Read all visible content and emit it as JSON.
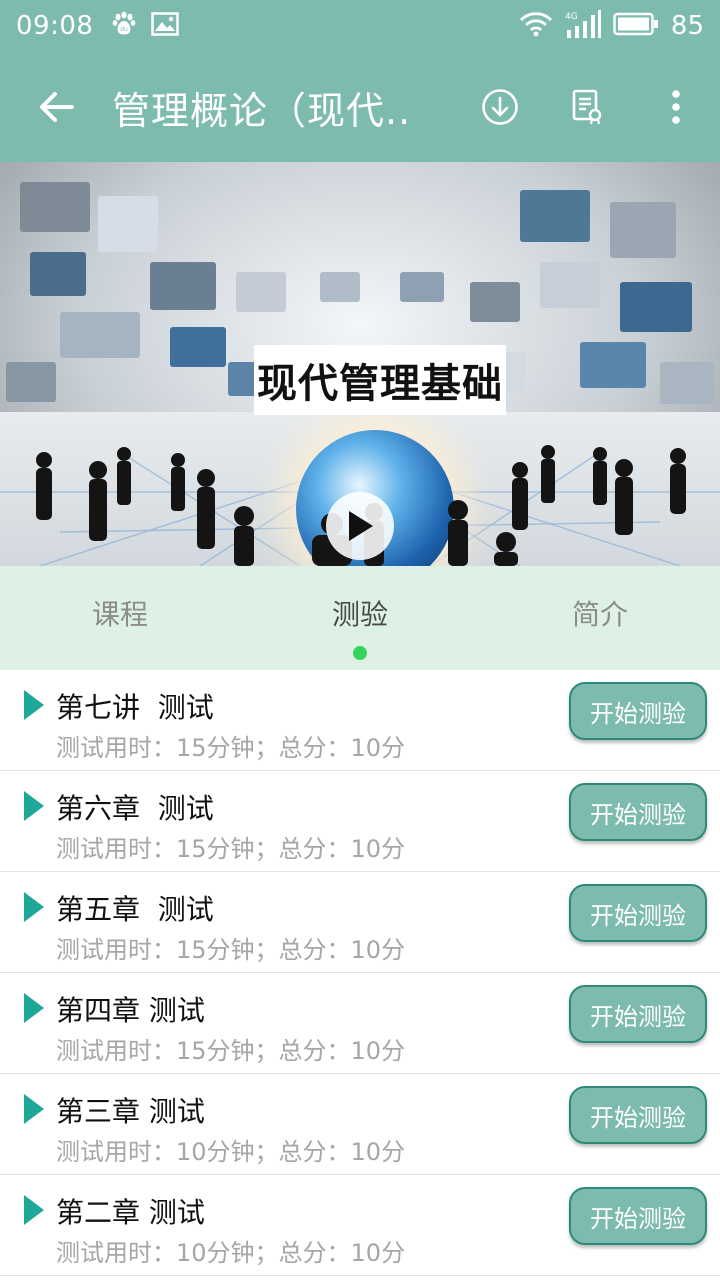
{
  "status_bar": {
    "time": "09:08",
    "battery_level": "85",
    "network": "4G",
    "icons": [
      "baidu-paw-icon",
      "image-icon",
      "wifi-icon",
      "signal-icon",
      "battery-icon"
    ]
  },
  "app_bar": {
    "title": "管理概论（现代..",
    "icons": [
      "back-arrow-icon",
      "download-icon",
      "certificate-icon",
      "more-vert-icon"
    ]
  },
  "video": {
    "banner_text": "现代管理基础",
    "play_icon": "play-icon"
  },
  "tabs": [
    {
      "label": "课程",
      "active": false
    },
    {
      "label": "测验",
      "active": true
    },
    {
      "label": "简介",
      "active": false
    }
  ],
  "quizzes": [
    {
      "title": "第七讲  测试",
      "meta": "测试用时：15分钟；总分：10分",
      "button": "开始测验"
    },
    {
      "title": "第六章  测试",
      "meta": "测试用时：15分钟；总分：10分",
      "button": "开始测验"
    },
    {
      "title": "第五章  测试",
      "meta": "测试用时：15分钟；总分：10分",
      "button": "开始测验"
    },
    {
      "title": "第四章 测试",
      "meta": "测试用时：15分钟；总分：10分",
      "button": "开始测验"
    },
    {
      "title": "第三章 测试",
      "meta": "测试用时：10分钟；总分：10分",
      "button": "开始测验"
    },
    {
      "title": "第二章 测试",
      "meta": "测试用时：10分钟；总分：10分",
      "button": "开始测验"
    }
  ],
  "colors": {
    "primary": "#7dbbae",
    "tab_background": "#ddf2e4",
    "active_dot": "#38d25a",
    "list_marker": "#1fa797",
    "button_border": "#2e8a78"
  }
}
